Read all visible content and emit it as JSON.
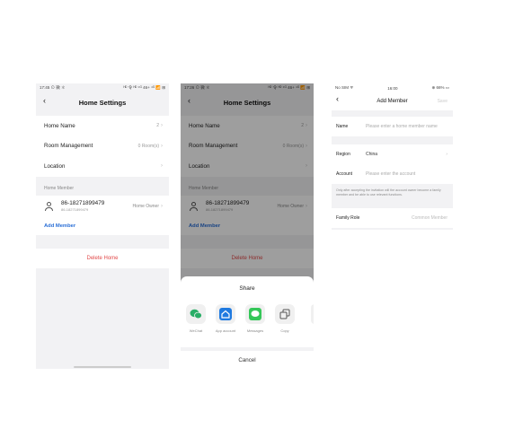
{
  "screen1": {
    "status": {
      "time": "17:45 ⊙ 微 ✽",
      "right": "ᴴᴰ 令 ᴴᴰ ⁴ᴳ 46+ ⁴ᴳ 📶 ⊞"
    },
    "title": "Home Settings",
    "rows": [
      {
        "label": "Home Name",
        "value": "2"
      },
      {
        "label": "Room Management",
        "value": "0 Room(s)"
      },
      {
        "label": "Location",
        "value": ""
      }
    ],
    "member_section": "Home Member",
    "member": {
      "name": "86-18271899479",
      "sub": "86-18271899479",
      "role": "Home Owner"
    },
    "add_member": "Add Member",
    "delete_home": "Delete Home"
  },
  "screen2": {
    "status": {
      "time": "17:26 ⊙ 微 ✽",
      "right": "ᴴᴰ 令 ᴴᴰ ⁴ᴳ 46+ ⁴ᴳ 📶 ⊞"
    },
    "title": "Home Settings",
    "rows": [
      {
        "label": "Home Name",
        "value": "2"
      },
      {
        "label": "Room Management",
        "value": "0 Room(s)"
      },
      {
        "label": "Location",
        "value": ""
      }
    ],
    "member_section": "Home Member",
    "member": {
      "name": "86-18271899479",
      "sub": "86-18271899479",
      "role": "Home Owner"
    },
    "add_member": "Add Member",
    "delete_home": "Delete Home",
    "share": {
      "title": "Share",
      "items": [
        {
          "label": "WeChat",
          "icon": "wechat-icon",
          "color": "#2aae67"
        },
        {
          "label": "App account",
          "icon": "home-icon",
          "color": "#1f7ae0"
        },
        {
          "label": "Messages",
          "icon": "messages-icon",
          "color": "#35c759"
        },
        {
          "label": "Copy",
          "icon": "copy-icon",
          "color": "#555555"
        }
      ],
      "cancel": "Cancel"
    }
  },
  "screen3": {
    "status": {
      "left": "No SIM ᯤ",
      "time": "16:00",
      "right": "⊕ 66% ▭"
    },
    "title": "Add Member",
    "save": "Save",
    "name_label": "Name",
    "name_placeholder": "Please enter a home member name",
    "region_label": "Region",
    "region_value": "China",
    "account_label": "Account",
    "account_placeholder": "Please enter the account",
    "note": "Only after accepting the invitation will the account owner become a family member and be able to use relevant functions.",
    "role_label": "Family Role",
    "role_value": "Common Member"
  },
  "colors": {
    "accent": "#2a6fd6",
    "danger": "#e24b4b",
    "background": "#f2f2f4"
  }
}
